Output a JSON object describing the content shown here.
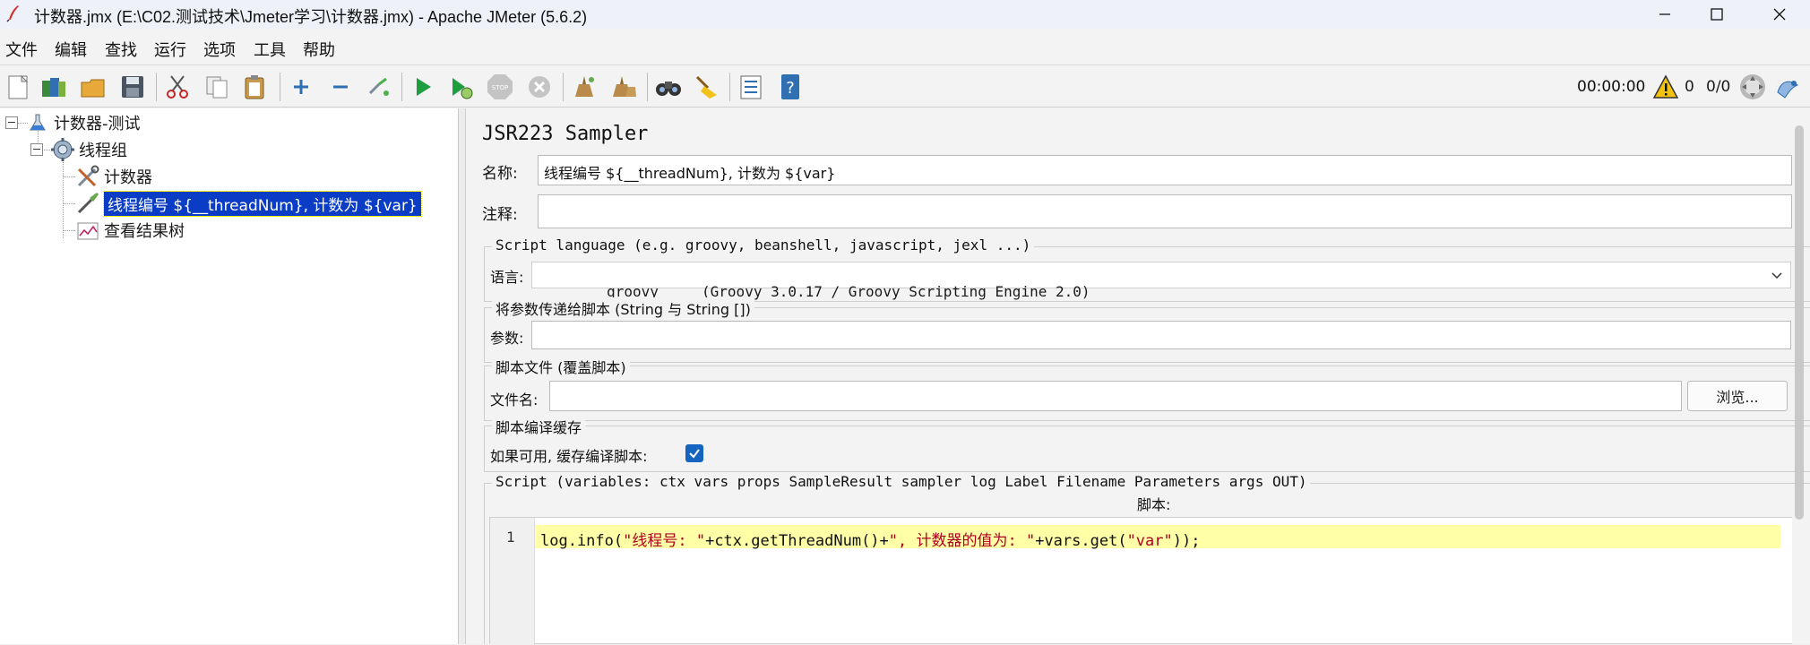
{
  "window": {
    "title": "计数器.jmx (E:\\C02.测试技术\\Jmeter学习\\计数器.jmx) - Apache JMeter (5.6.2)"
  },
  "menu": [
    "文件",
    "编辑",
    "查找",
    "运行",
    "选项",
    "工具",
    "帮助"
  ],
  "toolbar": {
    "icons": [
      "new-icon",
      "templates-icon",
      "open-icon",
      "save-icon",
      "cut-icon",
      "copy-icon",
      "paste-icon",
      "expand-icon",
      "collapse-icon",
      "toggle-icon",
      "start-icon",
      "start-no-pause-icon",
      "stop-icon",
      "shutdown-icon",
      "clear-icon",
      "clear-all-icon",
      "search-icon",
      "reset-search-icon",
      "function-helper-icon",
      "help-icon"
    ],
    "timer": "00:00:00",
    "warning_count": "0",
    "threads": "0/0"
  },
  "tree": {
    "items": [
      {
        "label": "计数器-测试",
        "icon": "test-plan-icon"
      },
      {
        "label": "线程组",
        "icon": "thread-group-icon"
      },
      {
        "label": "计数器",
        "icon": "counter-icon"
      },
      {
        "label": "线程编号 ${__threadNum}, 计数为 ${var}",
        "icon": "sampler-icon"
      },
      {
        "label": "查看结果树",
        "icon": "listener-icon"
      }
    ]
  },
  "panel": {
    "title": "JSR223 Sampler",
    "name_label": "名称:",
    "name_value": "线程编号 ${__threadNum}, 计数为 ${var}",
    "comment_label": "注释:",
    "comment_value": "",
    "script_language_group": "Script language (e.g. groovy, beanshell, javascript, jexl ...)",
    "language_label": "语言:",
    "language_value": "groovy     (Groovy 3.0.17 / Groovy Scripting Engine 2.0)",
    "params_group": "将参数传递给脚本 (String 与 String [])",
    "params_label": "参数:",
    "params_value": "",
    "script_file_group": "脚本文件 (覆盖脚本)",
    "filename_label": "文件名:",
    "filename_value": "",
    "browse_label": "浏览...",
    "cache_group": "脚本编译缓存",
    "cache_label": "如果可用, 缓存编译脚本:",
    "cache_checked": true,
    "script_group": "Script (variables: ctx vars props SampleResult sampler log Label Filename Parameters args OUT)",
    "script_label": "脚本:",
    "line_number": "1",
    "code_parts": [
      {
        "text": "log.info(",
        "type": "plain"
      },
      {
        "text": "\"线程号: \"",
        "type": "str"
      },
      {
        "text": "+ctx.getThreadNum()+",
        "type": "plain"
      },
      {
        "text": "\", 计数器的值为: \"",
        "type": "str"
      },
      {
        "text": "+vars.get(",
        "type": "plain"
      },
      {
        "text": "\"var\"",
        "type": "str"
      },
      {
        "text": "));",
        "type": "plain"
      }
    ]
  },
  "colors": {
    "selection": "#0a3cc6",
    "highlight_line": "#ffffa8",
    "checkbox": "#1565c0",
    "string": "#b00020"
  }
}
